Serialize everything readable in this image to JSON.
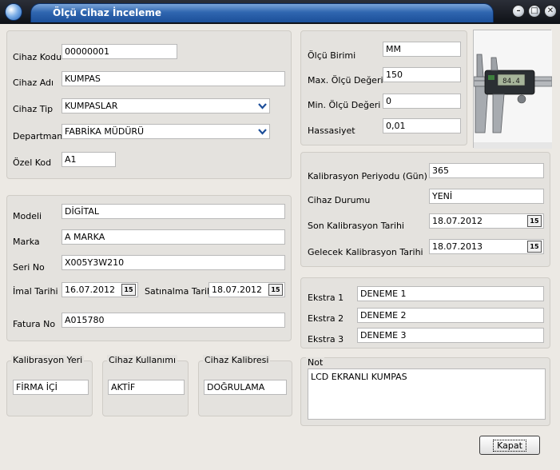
{
  "window": {
    "title": "Ölçü Cihaz İnceleme"
  },
  "general": {
    "cihaz_kodu": {
      "label": "Cihaz Kodu",
      "value": "00000001"
    },
    "cihaz_adi": {
      "label": "Cihaz Adı",
      "value": "KUMPAS"
    },
    "cihaz_tip": {
      "label": "Cihaz Tip",
      "value": "KUMPASLAR"
    },
    "departman": {
      "label": "Departman",
      "value": "FABRİKA MÜDÜRÜ"
    },
    "ozel_kod": {
      "label": "Özel Kod",
      "value": "A1"
    }
  },
  "measure": {
    "olcu_birimi": {
      "label": "Ölçü Birimi",
      "value": "MM"
    },
    "max_olcu": {
      "label": "Max. Ölçü Değeri",
      "value": "150"
    },
    "min_olcu": {
      "label": "Min. Ölçü Değeri",
      "value": "0"
    },
    "hassasiyet": {
      "label": "Hassasiyet",
      "value": "0,01"
    }
  },
  "details": {
    "modeli": {
      "label": "Modeli",
      "value": "DİGİTAL"
    },
    "marka": {
      "label": "Marka",
      "value": "A MARKA"
    },
    "seri_no": {
      "label": "Seri No",
      "value": "X005Y3W210"
    },
    "imal_tarihi": {
      "label": "İmal Tarihi",
      "value": "16.07.2012"
    },
    "satinalma_tarihi": {
      "label": "Satınalma Tarihi",
      "value": "18.07.2012"
    },
    "fatura_no": {
      "label": "Fatura No",
      "value": "A015780"
    }
  },
  "calibration": {
    "periyot": {
      "label": "Kalibrasyon Periyodu (Gün)",
      "value": "365"
    },
    "durum": {
      "label": "Cihaz Durumu",
      "value": "YENİ"
    },
    "son_tarih": {
      "label": "Son Kalibrasyon Tarihi",
      "value": "18.07.2012"
    },
    "gelecek_tarih": {
      "label": "Gelecek Kalibrasyon Tarihi",
      "value": "18.07.2013"
    }
  },
  "groups": {
    "kalibrasyon_yeri": {
      "label": "Kalibrasyon Yeri",
      "value": "FİRMA İÇİ"
    },
    "cihaz_kullanimi": {
      "label": "Cihaz Kullanımı",
      "value": "AKTİF"
    },
    "cihaz_kalibresi": {
      "label": "Cihaz Kalibresi",
      "value": "DOĞRULAMA"
    }
  },
  "extras": {
    "ekstra1": {
      "label": "Ekstra 1",
      "value": "DENEME 1"
    },
    "ekstra2": {
      "label": "Ekstra 2",
      "value": "DENEME 2"
    },
    "ekstra3": {
      "label": "Ekstra 3",
      "value": "DENEME 3"
    }
  },
  "note": {
    "label": "Not",
    "value": "LCD EKRANLI KUMPAS"
  },
  "photo": {
    "display_reading": "84.4"
  },
  "buttons": {
    "close_label": "Kapat"
  },
  "icons": {
    "calendar": "15",
    "combo": "⌄"
  }
}
